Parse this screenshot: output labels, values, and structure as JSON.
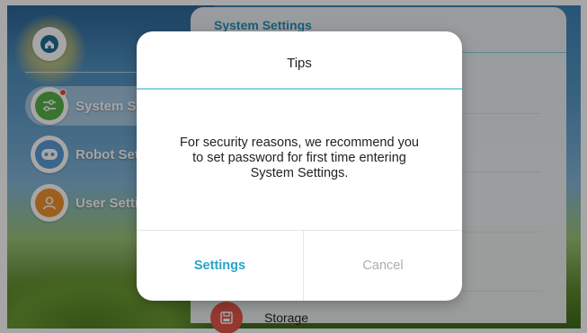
{
  "sidebar": {
    "items": [
      {
        "label": "System Settings",
        "icon": "sliders-icon",
        "color": "#56b14a",
        "active": true,
        "badge": true
      },
      {
        "label": "Robot Settings",
        "icon": "robot-icon",
        "color": "#5a9bd8",
        "active": false,
        "badge": false
      },
      {
        "label": "User Settings",
        "icon": "user-icon",
        "color": "#f0922e",
        "active": false,
        "badge": false
      }
    ]
  },
  "panel": {
    "title": "System Settings",
    "storage_label": "Storage"
  },
  "dialog": {
    "title": "Tips",
    "message_line1": "For security reasons, we recommend you",
    "message_line2": "to set password for first time entering",
    "message_line3": "System Settings.",
    "confirm_label": "Settings",
    "cancel_label": "Cancel"
  },
  "colors": {
    "accent": "#2aa3c7",
    "badge": "#e94a3d",
    "storage": "#e5564a"
  }
}
